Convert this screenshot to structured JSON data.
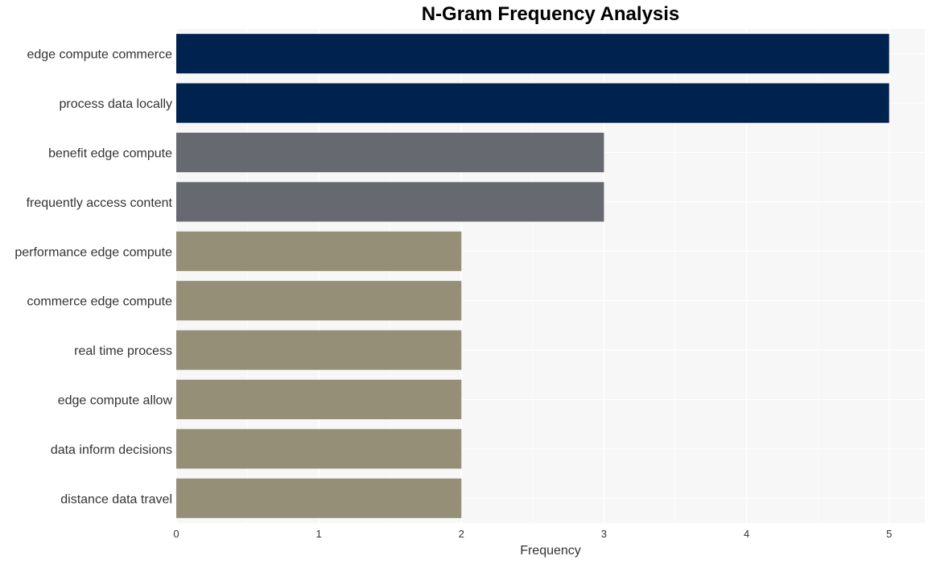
{
  "chart_data": {
    "type": "bar",
    "orientation": "horizontal",
    "title": "N-Gram Frequency Analysis",
    "xlabel": "Frequency",
    "ylabel": "",
    "xlim": [
      0,
      5.25
    ],
    "xticks": [
      "0",
      "1",
      "2",
      "3",
      "4",
      "5"
    ],
    "grid": true,
    "categories": [
      "edge compute commerce",
      "process data locally",
      "benefit edge compute",
      "frequently access content",
      "performance edge compute",
      "commerce edge compute",
      "real time process",
      "edge compute allow",
      "data inform decisions",
      "distance data travel"
    ],
    "values": [
      5,
      5,
      3,
      3,
      2,
      2,
      2,
      2,
      2,
      2
    ],
    "colors": [
      "#00224e",
      "#00224e",
      "#666970",
      "#666970",
      "#958f78",
      "#958f78",
      "#958f78",
      "#958f78",
      "#958f78",
      "#958f78"
    ],
    "background": "#f7f7f7"
  }
}
